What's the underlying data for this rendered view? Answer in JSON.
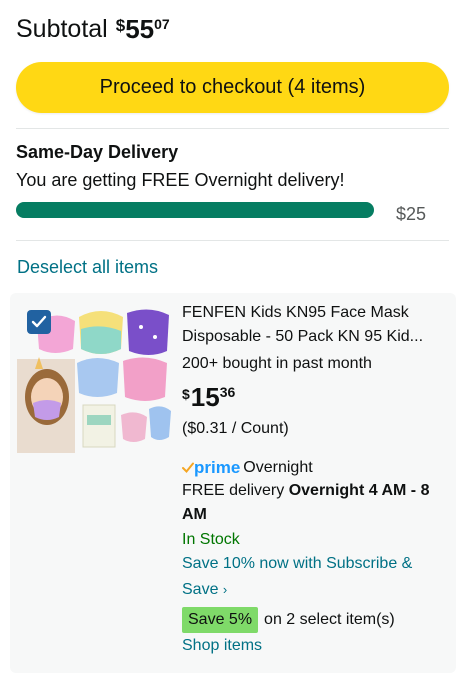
{
  "subtotal": {
    "label": "Subtotal",
    "currency": "$",
    "whole": "55",
    "fraction": "07"
  },
  "checkout": {
    "label": "Proceed to checkout (4 items)"
  },
  "delivery": {
    "title": "Same-Day Delivery",
    "message": "You are getting FREE Overnight delivery!",
    "progress": 1.0,
    "threshold": "$25",
    "bar_color": "#067d62"
  },
  "deselect_label": "Deselect all items",
  "item": {
    "checked": true,
    "title_line1": "FENFEN Kids KN95 Face Mask",
    "title_line2": "Disposable - 50 Pack KN 95 Kid...",
    "bought": "200+ bought in past month",
    "price": {
      "currency": "$",
      "whole": "15",
      "fraction": "36"
    },
    "unit_price": "($0.31 / Count)",
    "prime_label": "prime",
    "prime_speed": "Overnight",
    "free_delivery_prefix": "FREE delivery ",
    "free_delivery_time": "Overnight 4 AM - 8 AM",
    "stock": "In Stock",
    "subscribe": "Save 10% now with Subscribe & Save",
    "save_badge": "Save 5%",
    "save_text": "on 2 select item(s)",
    "shop_items": "Shop items"
  },
  "colors": {
    "checkout_bg": "#ffd814",
    "link": "#007185",
    "stock": "#007600",
    "save_badge": "#7fda69",
    "checkbox": "#2162a1",
    "prime": "#1a98ff"
  }
}
